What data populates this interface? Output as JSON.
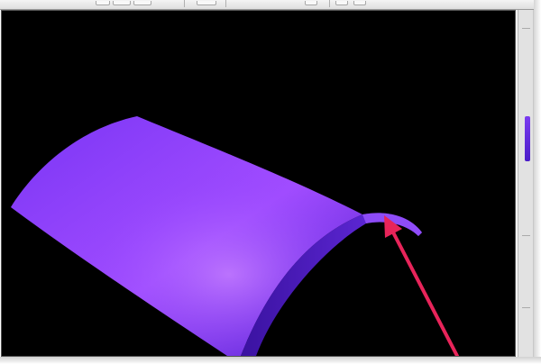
{
  "colors": {
    "viewport_background": "#000000",
    "surface_light": "#a24dff",
    "surface_mid": "#7a35f5",
    "surface_dark": "#4a1cc8",
    "arrow": "#e8245a"
  },
  "icons": {
    "annotation": "arrow-pointer",
    "panel_preview": "material-swatch"
  }
}
